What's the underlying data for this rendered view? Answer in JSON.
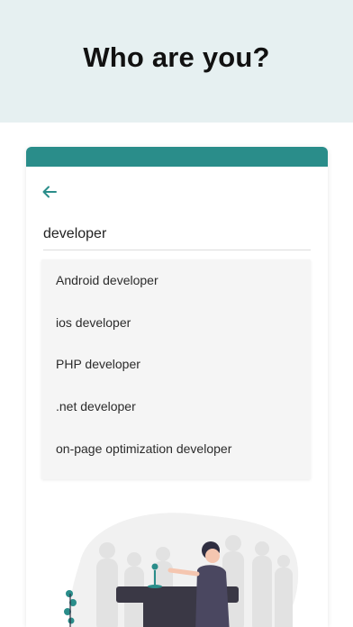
{
  "header": {
    "title": "Who are you?"
  },
  "search": {
    "value": "developer"
  },
  "suggestions": [
    {
      "label": "Android developer"
    },
    {
      "label": "ios developer"
    },
    {
      "label": "PHP developer"
    },
    {
      "label": ".net developer"
    },
    {
      "label": "on-page optimization developer"
    }
  ],
  "colors": {
    "header_bg": "#e6f0f1",
    "accent": "#2a8d8a",
    "suggestions_bg": "#f5f5f5"
  },
  "icons": {
    "back": "arrow-left-icon"
  }
}
